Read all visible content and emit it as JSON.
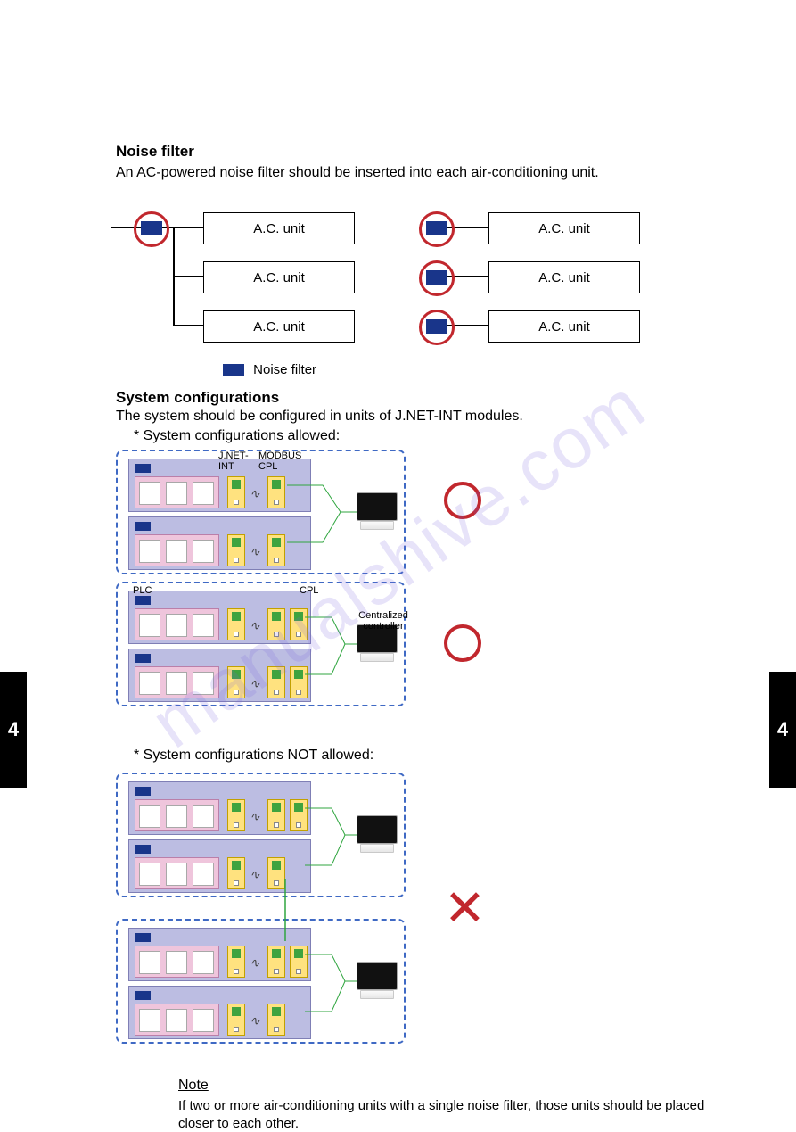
{
  "page_number": "4",
  "watermark": "manualshive.com",
  "headings": {
    "noise_filter_h": "Noise filter",
    "noise_filter_body": "An AC-powered noise filter should be inserted into each air-conditioning unit.",
    "system_config_h": "System configurations",
    "system_config_body": "The system should be configured in units of J.NET-INT modules.",
    "allowed_label": "* System configurations allowed:",
    "not_allowed_label": "* System configurations NOT allowed:",
    "note_label": "Note",
    "note_body": "If two or more air-conditioning units with a single noise filter, those units should be placed closer to each other."
  },
  "top_diagram": {
    "ac_unit_label": "A.C. unit",
    "noise_filter_label": "Noise filter"
  },
  "rack_labels": {
    "jnet": "J.NET-\nINT",
    "modbus_cpl": "MODBUS\nCPL",
    "plc": "PLC",
    "cpl": "CPL",
    "centralized_controller": "Centralized\ncontroller"
  }
}
